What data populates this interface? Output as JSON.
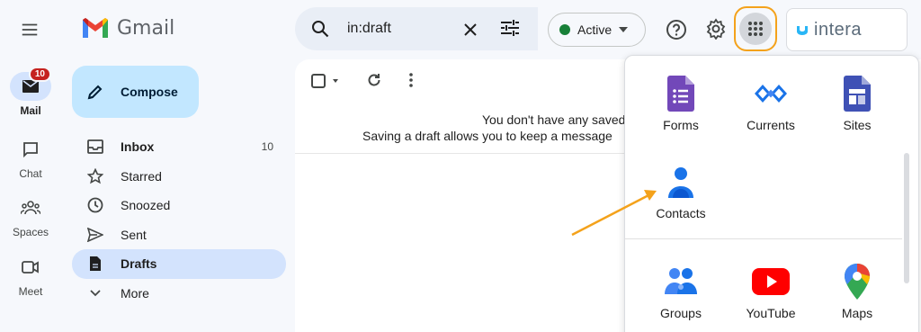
{
  "rail": {
    "items": [
      {
        "label": "Mail",
        "badge": "10"
      },
      {
        "label": "Chat"
      },
      {
        "label": "Spaces"
      },
      {
        "label": "Meet"
      }
    ]
  },
  "logo": {
    "text": "Gmail"
  },
  "compose": {
    "label": "Compose"
  },
  "nav": {
    "items": [
      {
        "label": "Inbox",
        "count": "10"
      },
      {
        "label": "Starred"
      },
      {
        "label": "Snoozed"
      },
      {
        "label": "Sent"
      },
      {
        "label": "Drafts"
      },
      {
        "label": "More"
      }
    ]
  },
  "search": {
    "value": "in:draft"
  },
  "status": {
    "label": "Active",
    "color": "#188038"
  },
  "account": {
    "name": "intera"
  },
  "main": {
    "empty_line1": "You don't have any saved",
    "empty_line2": "Saving a draft allows you to keep a message"
  },
  "apps": {
    "items": [
      {
        "label": "Forms",
        "icon": "forms-icon"
      },
      {
        "label": "Currents",
        "icon": "currents-icon"
      },
      {
        "label": "Sites",
        "icon": "sites-icon"
      },
      {
        "label": "Contacts",
        "icon": "contacts-icon"
      },
      {
        "label": "Groups",
        "icon": "groups-icon"
      },
      {
        "label": "YouTube",
        "icon": "youtube-icon"
      },
      {
        "label": "Maps",
        "icon": "maps-icon"
      }
    ]
  },
  "colors": {
    "accent": "#f4a21b",
    "compose_bg": "#c2e7ff",
    "active_bg": "#d3e3fd"
  }
}
